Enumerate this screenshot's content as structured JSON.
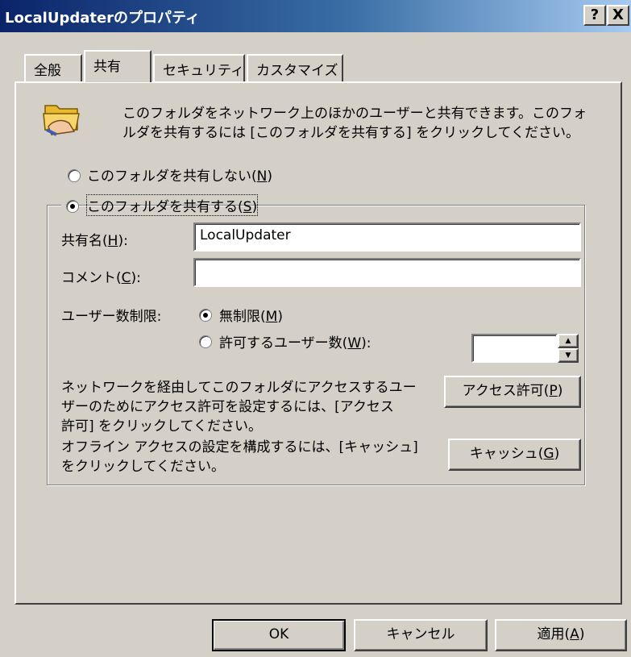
{
  "window": {
    "title": "LocalUpdaterのプロパティ",
    "help_button": "?",
    "close_button": "X"
  },
  "tabs": [
    {
      "label": "全般"
    },
    {
      "label": "共有"
    },
    {
      "label": "セキュリティ"
    },
    {
      "label": "カスタマイズ"
    }
  ],
  "description": "このフォルダをネットワーク上のほかのユーザーと共有できます。このフォルダを共有するには [このフォルダを共有する] をクリックしてください。",
  "description_line1": "このフォルダをネットワーク上のほかのユーザーと共有できます。このフォ",
  "description_line2": "ルダを共有するには [このフォルダを共有する] をクリックしてください。",
  "share_options": {
    "no_share": {
      "label": "このフォルダを共有しない",
      "mnemonic": "N",
      "selected": false
    },
    "share": {
      "label": "このフォルダを共有する",
      "mnemonic": "S",
      "selected": true
    }
  },
  "share_name": {
    "label": "共有名",
    "mnemonic": "H",
    "value": "LocalUpdater"
  },
  "comment": {
    "label": "コメント",
    "mnemonic": "C",
    "value": ""
  },
  "user_limit": {
    "label": "ユーザー数制限:",
    "unlimited": {
      "label": "無制限",
      "mnemonic": "M",
      "selected": true
    },
    "allowed": {
      "label": "許可するユーザー数",
      "mnemonic": "W",
      "selected": false,
      "value": ""
    }
  },
  "permissions": {
    "text_line1": "ネットワークを経由してこのフォルダにアクセスするユー",
    "text_line2": "ザーのためにアクセス許可を設定するには、[アクセス",
    "text_line3": "許可] をクリックしてください。",
    "button": {
      "label": "アクセス許可",
      "mnemonic": "P"
    }
  },
  "cache": {
    "text_line1": "オフライン アクセスの設定を構成するには、[キャッシュ]",
    "text_line2": "をクリックしてください。",
    "button": {
      "label": "キャッシュ",
      "mnemonic": "G"
    }
  },
  "footer": {
    "ok": "OK",
    "cancel": "キャンセル",
    "apply": {
      "label": "適用",
      "mnemonic": "A"
    }
  },
  "colors": {
    "titlebar": "#0a246a",
    "face": "#d4d0c8",
    "folder": "#f2c94c"
  },
  "icons": [
    "folder-share-icon",
    "spin-up-icon",
    "spin-down-icon"
  ]
}
